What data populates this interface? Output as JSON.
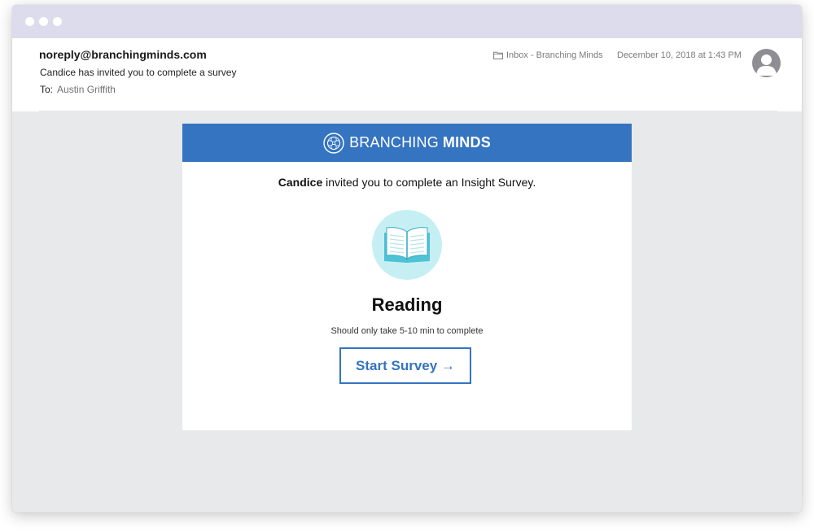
{
  "email": {
    "from": "noreply@branchingminds.com",
    "subject": "Candice has invited you to complete a survey",
    "to_label": "To:",
    "to_name": "Austin Griffith",
    "folder": "Inbox - Branching Minds",
    "date": "December 10, 2018 at 1:43 PM"
  },
  "card": {
    "brand_part1": "BRANCHING",
    "brand_part2": "MINDS",
    "invite_name": "Candice",
    "invite_rest": " invited you to complete an Insight Survey.",
    "survey_title": "Reading",
    "survey_subtitle": "Should only take 5-10 min to complete",
    "button_label": "Start Survey →"
  },
  "icons": {
    "window_controls": [
      "dot",
      "dot",
      "dot"
    ],
    "folder": "folder-icon",
    "avatar": "avatar-icon",
    "logo": "branching-minds-logo-icon",
    "book": "open-book-icon"
  },
  "colors": {
    "accent": "#3474c1",
    "titlebar": "#dddcec",
    "book_circle": "#c6eff4",
    "book": "#4ec3d6",
    "background": "#e8e9eb"
  }
}
